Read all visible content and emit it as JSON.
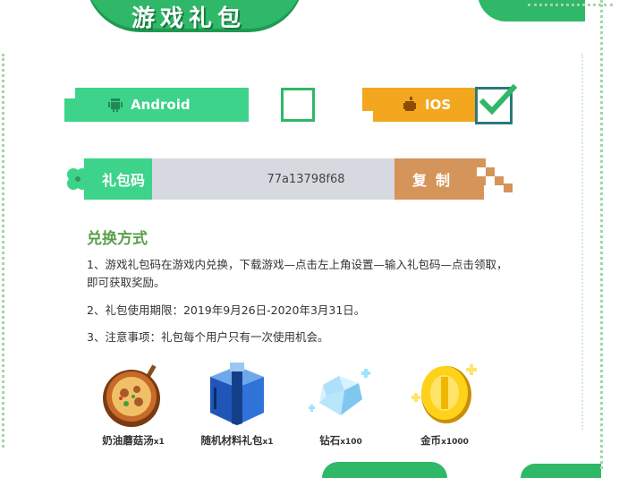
{
  "page_title": "游戏礼包",
  "platforms": {
    "android": {
      "label": "Android",
      "selected": false,
      "color": "#3dd38a"
    },
    "ios": {
      "label": "IOS",
      "selected": true,
      "color": "#f2a71f"
    }
  },
  "code": {
    "label": "礼包码",
    "value": "77a13798f68",
    "copy_label": "复制"
  },
  "redeem": {
    "heading": "兑换方式",
    "steps": [
      "1、游戏礼包码在游戏内兑换，下载游戏—点击左上角设置—输入礼包码—点击领取，即可获取奖励。",
      "2、礼包使用期限：2019年9月26日-2020年3月31日。",
      "3、注意事项：礼包每个用户只有一次使用机会。"
    ]
  },
  "rewards": [
    {
      "name": "奶油蘑菇汤",
      "qty": "x1",
      "icon": "mushroom-soup-icon"
    },
    {
      "name": "随机材料礼包",
      "qty": "x1",
      "icon": "gift-box-icon"
    },
    {
      "name": "钻石",
      "qty": "x100",
      "icon": "diamond-icon"
    },
    {
      "name": "金币",
      "qty": "x1000",
      "icon": "gold-coin-icon"
    }
  ],
  "colors": {
    "accent_green": "#3dd38a",
    "accent_orange": "#f2a71f",
    "copy_brown": "#d4945a",
    "heading_green": "#5a9e4a"
  }
}
